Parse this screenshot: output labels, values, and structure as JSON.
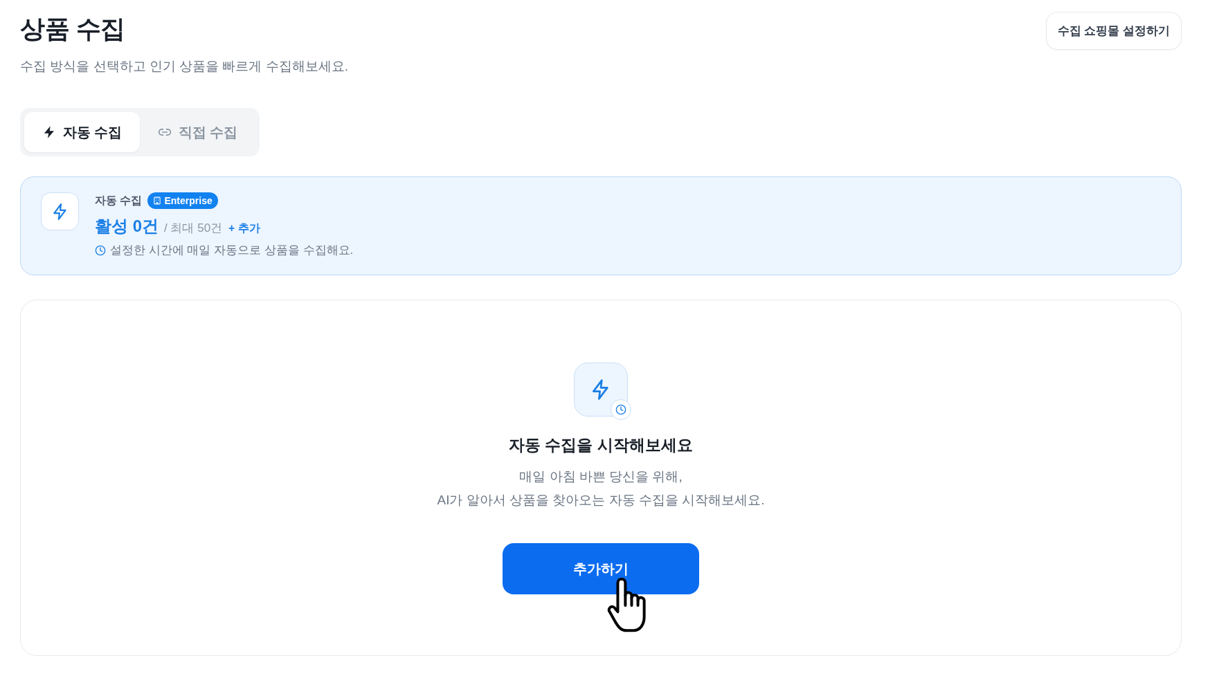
{
  "header": {
    "title": "상품 수집",
    "subtitle": "수집 방식을 선택하고 인기 상품을 빠르게 수집해보세요.",
    "settings_button": "수집 쇼핑몰 설정하기"
  },
  "tabs": [
    {
      "label": "자동 수집",
      "kind": "auto",
      "selected": true
    },
    {
      "label": "직접 수집",
      "kind": "manual",
      "selected": false
    }
  ],
  "summary_card": {
    "label": "자동 수집",
    "badge": "Enterprise",
    "active_count": "활성 0건",
    "limit": "/ 최대 50건",
    "add_link": "+ 추가",
    "note": "설정한 시간에 매일 자동으로 상품을 수집해요."
  },
  "empty_state": {
    "heading": "자동 수집을 시작해보세요",
    "description": [
      "매일 아침 바쁜 당신을 위해,",
      "AI가 알아서 상품을 찾아오는 자동 수집을 시작해보세요."
    ],
    "button": "추가하기"
  }
}
